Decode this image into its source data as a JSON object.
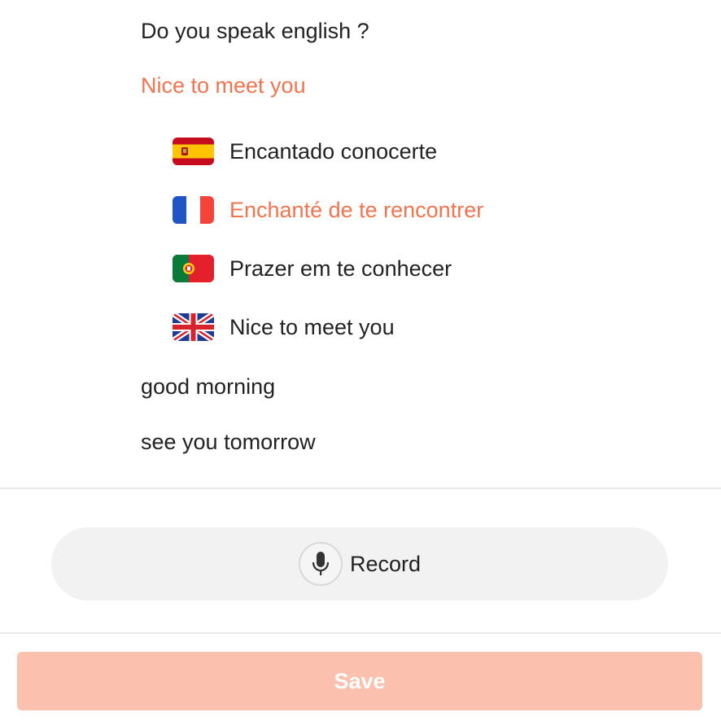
{
  "phrases": {
    "p1": "Do you speak english ?",
    "p2": "Nice to meet you",
    "p3": "good morning",
    "p4": "see you tomorrow"
  },
  "translations": [
    {
      "language_flag": "spain-flag-icon",
      "text": "Encantado conocerte"
    },
    {
      "language_flag": "france-flag-icon",
      "text": "Enchanté de te rencontrer"
    },
    {
      "language_flag": "portugal-flag-icon",
      "text": "Prazer em te conhecer"
    },
    {
      "language_flag": "uk-flag-icon",
      "text": "Nice to meet you"
    }
  ],
  "record": {
    "label": "Record",
    "icon": "microphone-icon"
  },
  "save": {
    "label": "Save"
  },
  "colors": {
    "accent": "#f4734f",
    "text": "#222222",
    "save_bg": "#fcc0ae",
    "record_bg": "#f2f2f2"
  }
}
